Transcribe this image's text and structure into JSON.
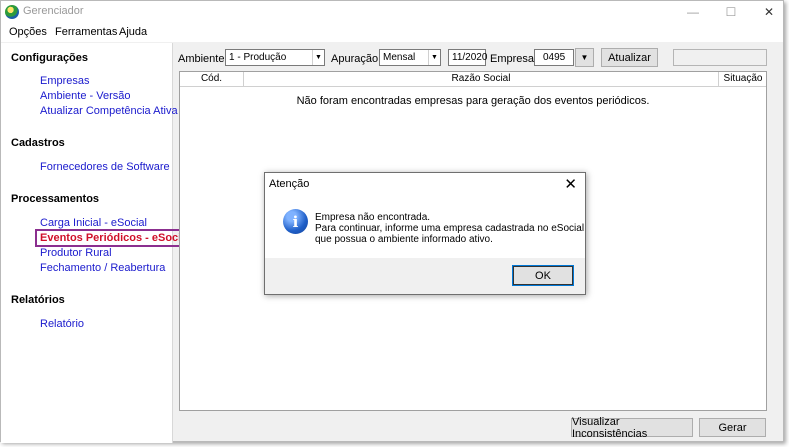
{
  "window": {
    "title": "Gerenciador"
  },
  "titlebar_buttons": {
    "minimize": "—",
    "maximize": "☐",
    "close": "✕"
  },
  "menu": [
    "Opções",
    "Ferramentas",
    "Ajuda"
  ],
  "sidebar": {
    "sections": [
      {
        "title": "Configurações",
        "items": [
          "Empresas",
          "Ambiente - Versão",
          "Atualizar Competência Ativa"
        ]
      },
      {
        "title": "Cadastros",
        "items": [
          "Fornecedores de Software"
        ]
      },
      {
        "title": "Processamentos",
        "items": [
          "Carga Inicial - eSocial",
          "Eventos Periódicos - eSocial",
          "Produtor Rural",
          "Fechamento / Reabertura"
        ]
      },
      {
        "title": "Relatórios",
        "items": [
          "Relatório"
        ]
      }
    ],
    "active_item": "Eventos Periódicos - eSocial"
  },
  "toolbar": {
    "ambiente_label": "Ambiente:",
    "ambiente_value": "1 - Produção",
    "apuracao_label": "Apuração:",
    "apuracao_value": "Mensal",
    "periodo_value": "11/2020",
    "empresa_label": "Empresa:",
    "empresa_value": "0495",
    "atualizar_label": "Atualizar"
  },
  "grid": {
    "columns": [
      "Cód.",
      "Razão Social",
      "Situação"
    ],
    "empty_message": "Não foram encontradas empresas para geração dos eventos periódicos."
  },
  "footer": {
    "inconsistencias_label": "Visualizar Inconsistências",
    "gerar_label": "Gerar"
  },
  "dialog": {
    "title": "Atenção",
    "lines": [
      "Empresa não encontrada.",
      "Para continuar, informe uma empresa cadastrada no eSocial",
      "que possua o ambiente informado ativo."
    ],
    "ok_label": "OK",
    "icon": "info-icon"
  }
}
